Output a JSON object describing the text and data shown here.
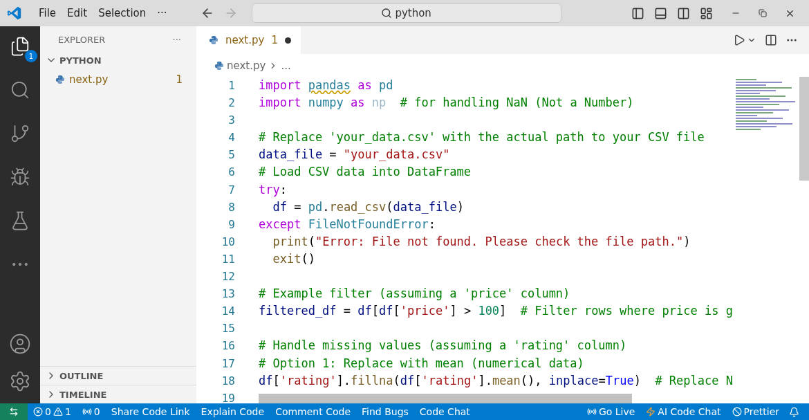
{
  "menu": [
    "File",
    "Edit",
    "Selection",
    "···"
  ],
  "command_center": {
    "value": "python"
  },
  "activity_bar": [
    {
      "kind": "explorer",
      "selected": true,
      "badge": "1"
    },
    {
      "kind": "search",
      "selected": false
    },
    {
      "kind": "git",
      "selected": false
    },
    {
      "kind": "debug",
      "selected": false
    },
    {
      "kind": "testing",
      "selected": false
    },
    {
      "kind": "more",
      "selected": false
    }
  ],
  "activity_bottom": [
    {
      "kind": "account"
    },
    {
      "kind": "settings"
    }
  ],
  "sidebar": {
    "title": "EXPLORER",
    "actions": "···",
    "folder": {
      "name": "PYTHON",
      "expanded": true,
      "files": [
        {
          "name": "next.py",
          "problems": "1"
        }
      ]
    },
    "sections": [
      {
        "name": "OUTLINE",
        "expanded": false
      },
      {
        "name": "TIMELINE",
        "expanded": false
      }
    ]
  },
  "tabs": [
    {
      "label": "next.py",
      "problems": "1",
      "dirty": true,
      "selected": true
    }
  ],
  "breadcrumb": [
    "next.py",
    "..."
  ],
  "code": [
    {
      "number": "1",
      "tokens": [
        {
          "text": "import ",
          "kind": "kw"
        },
        {
          "text": "pandas",
          "kind": "warn"
        },
        {
          "text": " as ",
          "kind": "kw"
        },
        {
          "text": "pd",
          "kind": "mod"
        }
      ]
    },
    {
      "number": "2",
      "tokens": [
        {
          "text": "import ",
          "kind": "kw"
        },
        {
          "text": "numpy",
          "kind": "mod"
        },
        {
          "text": " as ",
          "kind": "kw"
        },
        {
          "text": "np",
          "kind": "faded"
        },
        {
          "text": "  # for handling NaN (Not a Number)",
          "kind": "cmt"
        }
      ]
    },
    {
      "number": "3"
    },
    {
      "number": "4",
      "tokens": [
        {
          "text": "# Replace 'your_data.csv' with the actual path to your CSV file",
          "kind": "cmt"
        }
      ]
    },
    {
      "number": "5",
      "tokens": [
        {
          "text": "data_file",
          "kind": "var"
        },
        {
          "text": " = ",
          "kind": "plain"
        },
        {
          "text": "\"your_data.csv\"",
          "kind": "str"
        }
      ]
    },
    {
      "number": "6",
      "tokens": [
        {
          "text": "# Load CSV data into DataFrame",
          "kind": "cmt"
        }
      ]
    },
    {
      "number": "7",
      "tokens": [
        {
          "text": "try",
          "kind": "kw"
        },
        {
          "text": ":",
          "kind": "plain"
        }
      ]
    },
    {
      "number": "8",
      "tokens": [
        {
          "text": "  df",
          "kind": "var"
        },
        {
          "text": " = ",
          "kind": "plain"
        },
        {
          "text": "pd",
          "kind": "mod"
        },
        {
          "text": ".",
          "kind": "plain"
        },
        {
          "text": "read_csv",
          "kind": "fn"
        },
        {
          "text": "(",
          "kind": "plain"
        },
        {
          "text": "data_file",
          "kind": "var"
        },
        {
          "text": ")",
          "kind": "plain"
        }
      ]
    },
    {
      "number": "9",
      "tokens": [
        {
          "text": "except ",
          "kind": "kw"
        },
        {
          "text": "FileNotFoundError",
          "kind": "mod"
        },
        {
          "text": ":",
          "kind": "plain"
        }
      ]
    },
    {
      "number": "10",
      "tokens": [
        {
          "text": "  print",
          "kind": "fn"
        },
        {
          "text": "(",
          "kind": "plain"
        },
        {
          "text": "\"Error: File not found. Please check the file path.\"",
          "kind": "str"
        },
        {
          "text": ")",
          "kind": "plain"
        }
      ]
    },
    {
      "number": "11",
      "tokens": [
        {
          "text": "  exit",
          "kind": "fn"
        },
        {
          "text": "()",
          "kind": "plain"
        }
      ]
    },
    {
      "number": "12"
    },
    {
      "number": "13",
      "tokens": [
        {
          "text": "# Example filter (assuming a 'price' column)",
          "kind": "cmt"
        }
      ]
    },
    {
      "number": "14",
      "tokens": [
        {
          "text": "filtered_df",
          "kind": "var"
        },
        {
          "text": " = ",
          "kind": "plain"
        },
        {
          "text": "df",
          "kind": "var"
        },
        {
          "text": "[",
          "kind": "plain"
        },
        {
          "text": "df",
          "kind": "var"
        },
        {
          "text": "[",
          "kind": "plain"
        },
        {
          "text": "'price'",
          "kind": "str"
        },
        {
          "text": "] > ",
          "kind": "plain"
        },
        {
          "text": "100",
          "kind": "num"
        },
        {
          "text": "]  ",
          "kind": "plain"
        },
        {
          "text": "# Filter rows where price is g",
          "kind": "cmt"
        }
      ]
    },
    {
      "number": "15"
    },
    {
      "number": "16",
      "tokens": [
        {
          "text": "# Handle missing values (assuming a 'rating' column)",
          "kind": "cmt"
        }
      ]
    },
    {
      "number": "17",
      "tokens": [
        {
          "text": "# Option 1: Replace with mean (numerical data)",
          "kind": "cmt"
        }
      ]
    },
    {
      "number": "18",
      "tokens": [
        {
          "text": "df",
          "kind": "var"
        },
        {
          "text": "[",
          "kind": "plain"
        },
        {
          "text": "'rating'",
          "kind": "str"
        },
        {
          "text": "].",
          "kind": "plain"
        },
        {
          "text": "fillna",
          "kind": "fn"
        },
        {
          "text": "(",
          "kind": "plain"
        },
        {
          "text": "df",
          "kind": "var"
        },
        {
          "text": "[",
          "kind": "plain"
        },
        {
          "text": "'rating'",
          "kind": "str"
        },
        {
          "text": "].",
          "kind": "plain"
        },
        {
          "text": "mean",
          "kind": "fn"
        },
        {
          "text": "(), ",
          "kind": "plain"
        },
        {
          "text": "inplace",
          "kind": "var"
        },
        {
          "text": "=",
          "kind": "plain"
        },
        {
          "text": "True",
          "kind": "const"
        },
        {
          "text": ")  ",
          "kind": "plain"
        },
        {
          "text": "# Replace N",
          "kind": "cmt"
        }
      ]
    },
    {
      "number": "19"
    }
  ],
  "status_left": [
    {
      "kind": "problems",
      "errors": "0",
      "warnings": "1"
    },
    {
      "kind": "ports",
      "text": "0"
    },
    {
      "kind": "text",
      "text": "Share Code Link"
    },
    {
      "kind": "text",
      "text": "Explain Code"
    },
    {
      "kind": "text",
      "text": "Comment Code"
    },
    {
      "kind": "text",
      "text": "Find Bugs"
    },
    {
      "kind": "text",
      "text": "Code Chat"
    }
  ],
  "status_right": [
    {
      "kind": "live",
      "text": "Go Live"
    },
    {
      "kind": "ai",
      "text": "AI Code Chat"
    },
    {
      "kind": "prettier",
      "text": "Prettier"
    },
    {
      "kind": "bell"
    }
  ]
}
